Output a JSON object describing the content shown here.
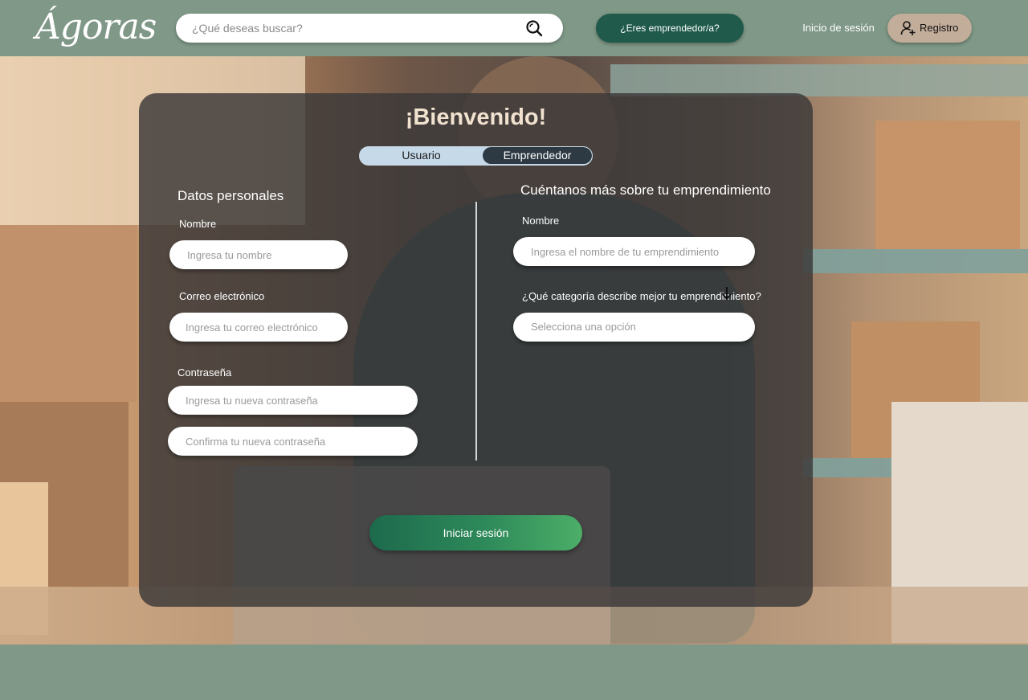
{
  "header": {
    "logo": "Ágoras",
    "search": {
      "placeholder": "¿Qué deseas buscar?",
      "value": ""
    },
    "entrepreneur_button": "¿Eres emprendedor/a?",
    "login_link": "Inicio de sesión",
    "register_button": "Registro"
  },
  "card": {
    "title": "¡Bienvenido!",
    "toggle": {
      "user": "Usuario",
      "entrepreneur": "Emprendedor",
      "selected": "Emprendedor"
    },
    "personal": {
      "title": "Datos personales",
      "name_label": "Nombre",
      "name_placeholder": "Ingresa tu nombre",
      "email_label": "Correo electrónico",
      "email_placeholder": "Ingresa tu correo electrónico",
      "password_label": "Contraseña",
      "password_placeholder": "Ingresa tu nueva contraseña",
      "password_confirm_placeholder": "Confirma tu nueva contraseña"
    },
    "business": {
      "title": "Cuéntanos más sobre tu emprendimiento",
      "name_label": "Nombre",
      "name_placeholder": "Ingresa el nombre de tu emprendimiento",
      "category_label": "¿Qué categoría describe mejor tu emprendimiento?",
      "category_value": "Selecciona una opción"
    },
    "submit_button": "Iniciar sesión"
  },
  "colors": {
    "header_bg": "#7f9887",
    "entrepreneur_button_bg": "#1f5a4a",
    "register_button_bg": "#c2ad9a",
    "title_color": "#f1e2cf",
    "submit_gradient_start": "#1d6a4d",
    "submit_gradient_end": "#4cae68"
  }
}
